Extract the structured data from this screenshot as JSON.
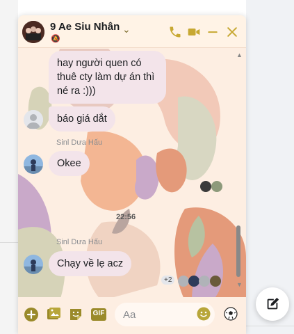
{
  "chat": {
    "title": "9 Ae Siu Nhân",
    "accent": "#c7a832",
    "icons": [
      "phone-icon",
      "video-icon",
      "minimize-icon",
      "close-icon",
      "chevron-down-icon",
      "muted-icon"
    ]
  },
  "messages": [
    {
      "text": "hay người quen có thuê cty làm dự án thì né ra :)))"
    },
    {
      "text": "báo giá dắt"
    },
    {
      "sender": "Sinl Dưa Hấu",
      "text": "Okee"
    },
    {
      "timestamp": "22:56"
    },
    {
      "sender": "Sinl Dưa Hấu",
      "text": "Chạy về lẹ acz",
      "seen_extra": "+2"
    }
  ],
  "composer": {
    "placeholder": "Aa",
    "icons": [
      "plus-icon",
      "photo-icon",
      "sticker-icon",
      "gif-icon",
      "emoji-icon",
      "soccer-ball-icon"
    ],
    "gif_label": "GIF"
  },
  "new_message_button": {
    "icon": "compose-icon"
  }
}
